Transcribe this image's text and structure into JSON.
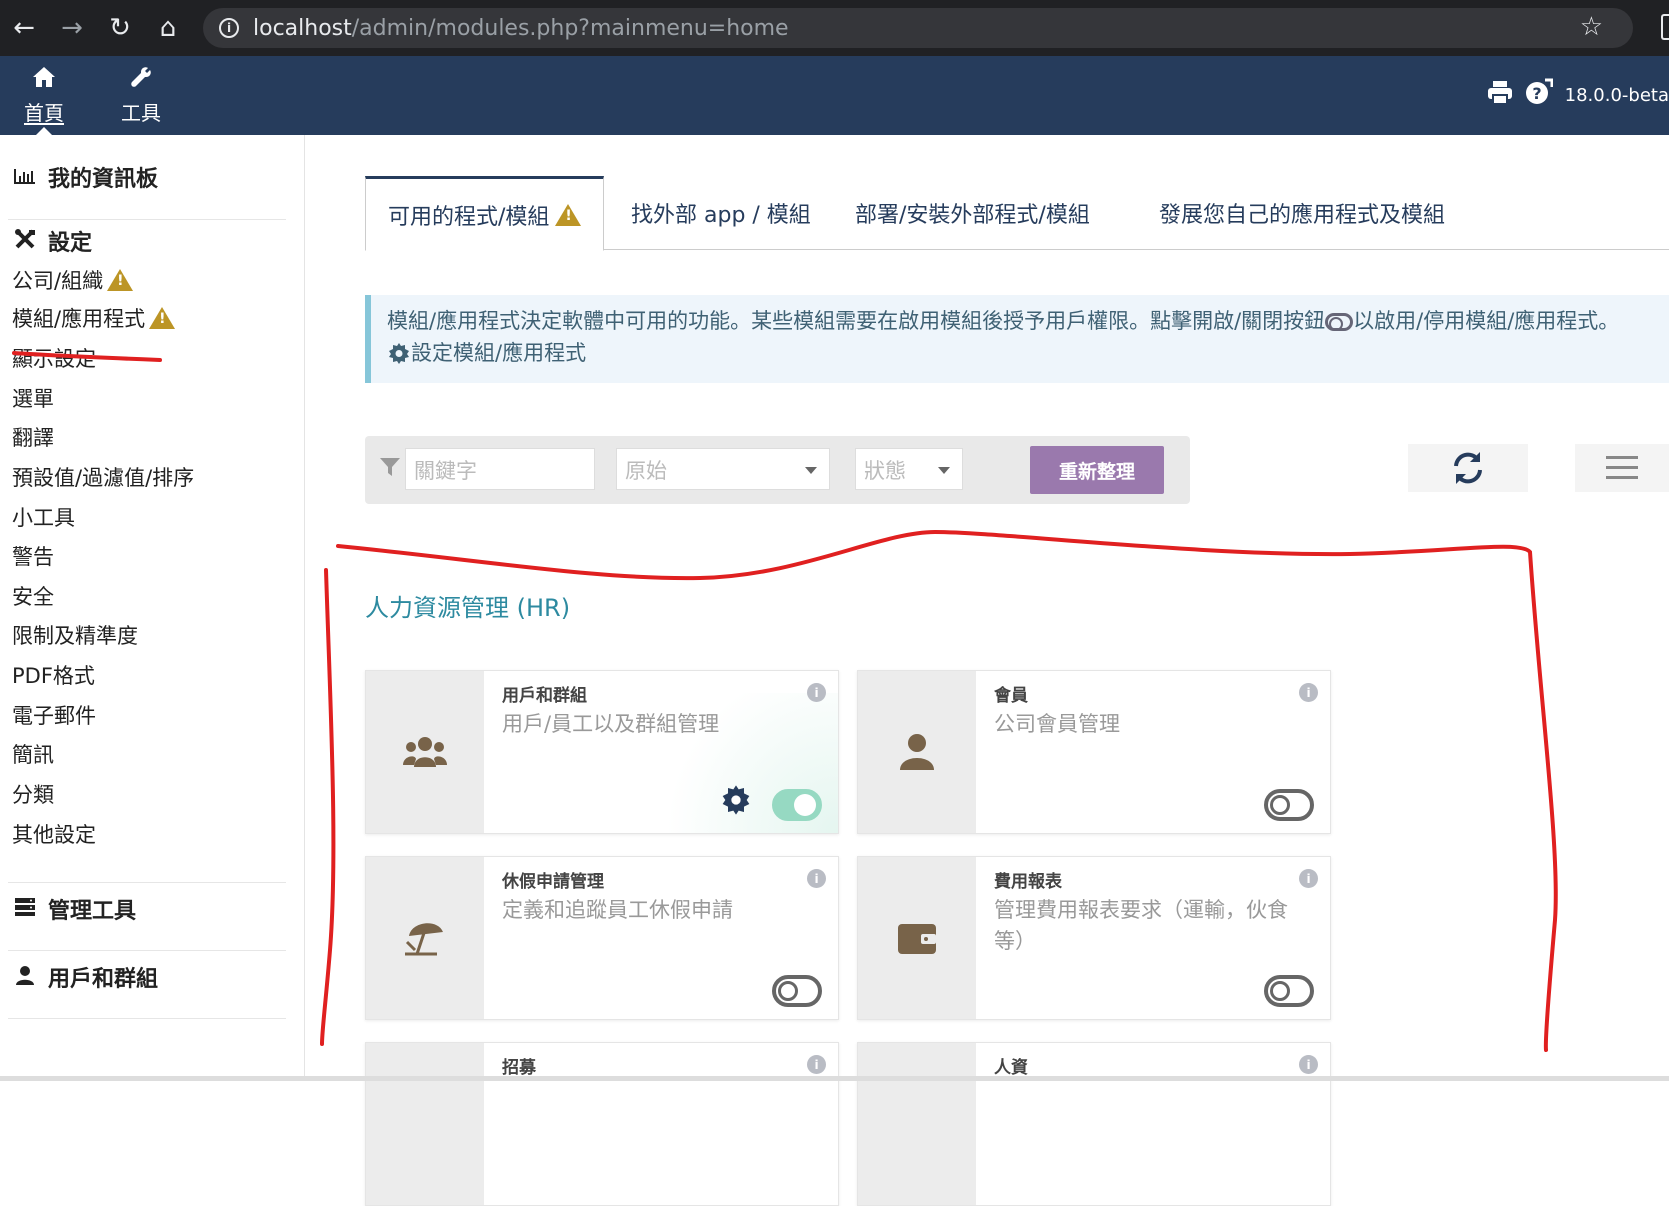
{
  "browser": {
    "url_host": "localhost",
    "url_path": "/admin/modules.php?mainmenu=home"
  },
  "topbar": {
    "menus": [
      {
        "label": "首頁",
        "icon": "home-icon"
      },
      {
        "label": "工具",
        "icon": "wrench-icon"
      }
    ],
    "version": "18.0.0-beta"
  },
  "sidebar": {
    "dashboard": "我的資訊板",
    "setup": "設定",
    "setup_items": [
      "公司/組織",
      "模組/應用程式",
      "顯示設定",
      "選單",
      "翻譯",
      "預設值/過濾值/排序",
      "小工具",
      "警告",
      "安全",
      "限制及精準度",
      "PDF格式",
      "電子郵件",
      "簡訊",
      "分類",
      "其他設定"
    ],
    "admin_tools": "管理工具",
    "users_groups": "用戶和群組"
  },
  "tabs": [
    "可用的程式/模組",
    "找外部 app / 模組",
    "部署/安裝外部程式/模組",
    "發展您自己的應用程式及模組"
  ],
  "info": {
    "line1a": "模組/應用程式決定軟體中可用的功能。某些模組需要在啟用模組後授予用戶權限。點擊開啟/關閉按鈕",
    "line1b": "以啟用/停用模組/應用程式。",
    "line2": "設定模組/應用程式"
  },
  "filters": {
    "keyword_placeholder": "關鍵字",
    "origin_placeholder": "原始",
    "status_placeholder": "狀態",
    "refresh_label": "重新整理"
  },
  "section": {
    "title": "人力資源管理 (HR)"
  },
  "modules": [
    {
      "title": "用戶和群組",
      "desc": "用戶/員工以及群組管理",
      "enabled": true,
      "icon": "users-icon"
    },
    {
      "title": "會員",
      "desc": "公司會員管理",
      "enabled": false,
      "icon": "user-icon"
    },
    {
      "title": "休假申請管理",
      "desc": "定義和追蹤員工休假申請",
      "enabled": false,
      "icon": "beach-umbrella-icon"
    },
    {
      "title": "費用報表",
      "desc": "管理費用報表要求（運輸，伙食等）",
      "enabled": false,
      "icon": "wallet-icon"
    },
    {
      "title": "招募",
      "desc": "",
      "enabled": false,
      "icon": "recruitment-icon"
    },
    {
      "title": "人資",
      "desc": "",
      "enabled": false,
      "icon": "hr-icon"
    }
  ],
  "colors": {
    "topbar": "#263c5c",
    "accent": "#9a79ad",
    "section_title": "#2d8aa0",
    "toggle_on": "#96d9c2",
    "warning": "#bc9526",
    "annotation": "#e02020"
  }
}
